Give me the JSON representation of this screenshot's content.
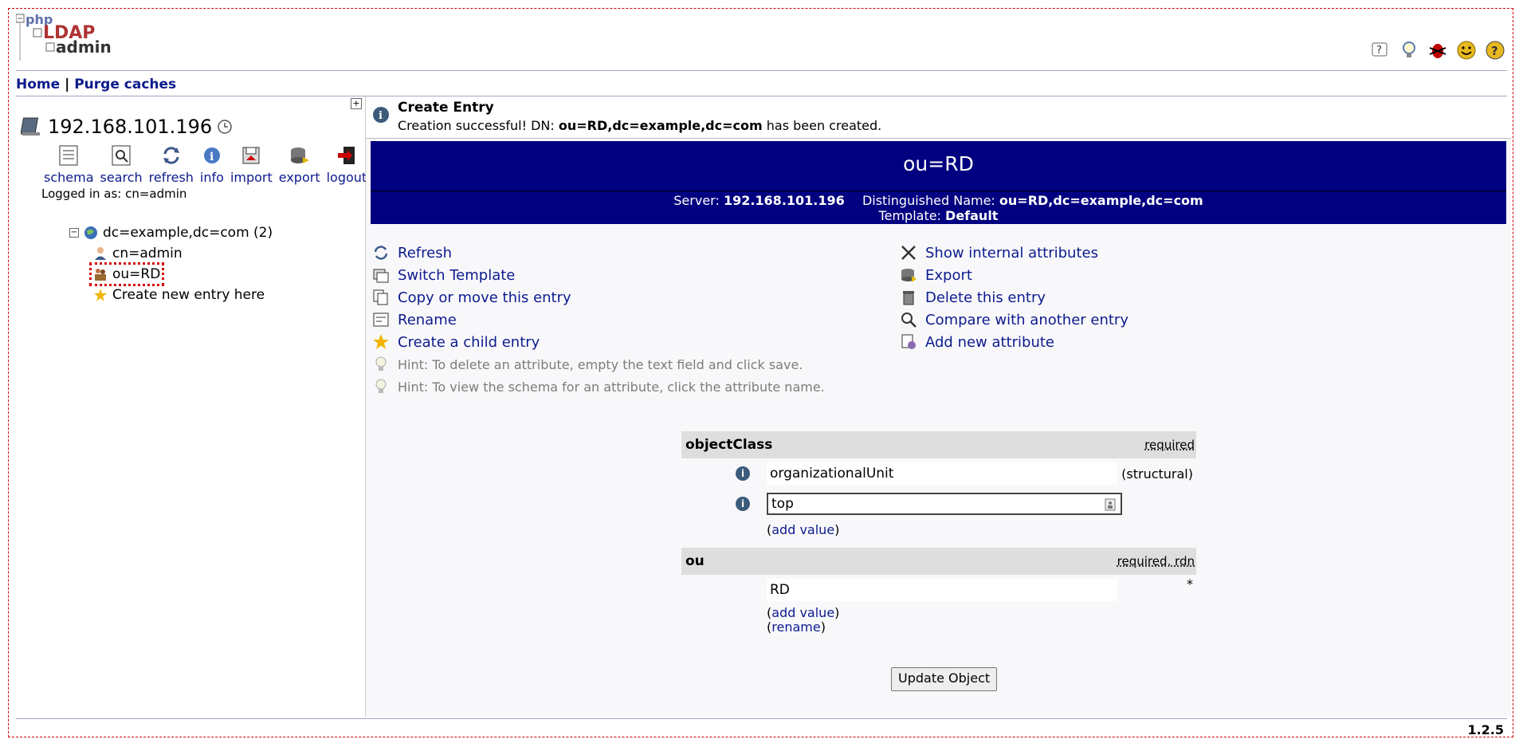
{
  "nav": {
    "home": "Home",
    "sep": " | ",
    "purge": "Purge caches"
  },
  "logo": {
    "line1": "php",
    "line2": "LDAP",
    "line3": "admin"
  },
  "top_icons": [
    "help-icon",
    "hint-icon",
    "bug-icon",
    "smile-icon",
    "question-icon"
  ],
  "server": {
    "host": "192.168.101.196"
  },
  "tools": [
    {
      "label": "schema",
      "icon": "schema-icon"
    },
    {
      "label": "search",
      "icon": "search-icon"
    },
    {
      "label": "refresh",
      "icon": "refresh-icon"
    },
    {
      "label": "info",
      "icon": "info-icon"
    },
    {
      "label": "import",
      "icon": "import-icon"
    },
    {
      "label": "export",
      "icon": "export-icon"
    },
    {
      "label": "logout",
      "icon": "logout-icon"
    }
  ],
  "logged_in": "Logged in as: cn=admin",
  "tree": {
    "root": "dc=example,dc=com (2)",
    "children": [
      "cn=admin",
      "ou=RD"
    ],
    "create": "Create new entry here"
  },
  "message": {
    "title": "Create Entry",
    "prefix": "Creation successful! DN: ",
    "dn": "ou=RD,dc=example,dc=com",
    "suffix": " has been created."
  },
  "banner": {
    "dn": "ou=RD",
    "server_label": "Server: ",
    "server_value": "192.168.101.196",
    "dn_label": "Distinguished Name: ",
    "dn_value": "ou=RD,dc=example,dc=com",
    "template_label": "Template: ",
    "template_value": "Default"
  },
  "actions_left": [
    "Refresh",
    "Switch Template",
    "Copy or move this entry",
    "Rename",
    "Create a child entry"
  ],
  "actions_right": [
    "Show internal attributes",
    "Export",
    "Delete this entry",
    "Compare with another entry",
    "Add new attribute"
  ],
  "hints": [
    "Hint: To delete an attribute, empty the text field and click save.",
    "Hint: To view the schema for an attribute, click the attribute name."
  ],
  "attributes": {
    "objectclass": {
      "name": "objectClass",
      "req": "required",
      "value1": "organizationalUnit",
      "value1_note": "(structural)",
      "value2": "top",
      "add": "add value"
    },
    "ou": {
      "name": "ou",
      "req": "required, rdn",
      "value": "RD",
      "star": "*",
      "add": "add value",
      "rename": "rename"
    }
  },
  "update_button": "Update Object",
  "version": "1.2.5",
  "colors": {
    "banner": "#000080",
    "link": "#0d1b8c"
  }
}
